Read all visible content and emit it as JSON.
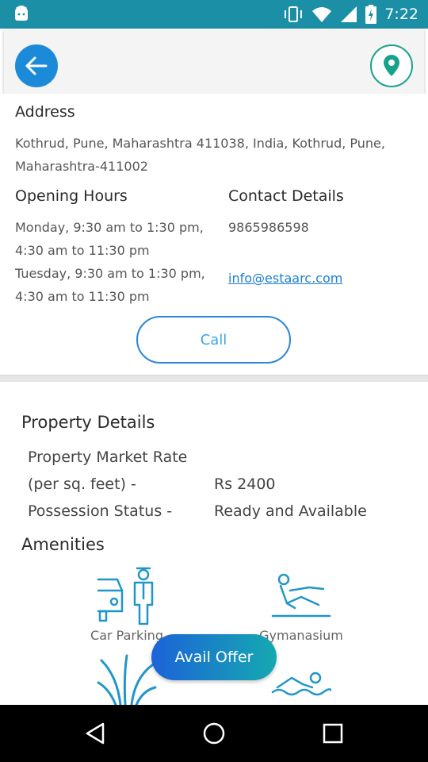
{
  "status_bar": {
    "time": "7:22",
    "color": "#1b8fa5"
  },
  "app_bar": {
    "back_icon": "arrow-left-icon",
    "location_icon": "map-pin-icon"
  },
  "address": {
    "heading": "Address",
    "line1": "Kothrud, Pune, Maharashtra 411038, India, Kothrud, Pune,",
    "line2": "Maharashtra-411002"
  },
  "opening_hours": {
    "heading": "Opening Hours",
    "lines": [
      "Monday, 9:30 am to 1:30 pm,",
      "4:30 am to 11:30 pm",
      "Tuesday, 9:30 am to 1:30 pm,",
      "4:30 am to 11:30 pm"
    ]
  },
  "contact": {
    "heading": "Contact Details",
    "phone": "9865986598",
    "email": "info@estaarc.com"
  },
  "call_label": "Call",
  "property": {
    "heading": "Property Details",
    "rate_label_1": "Property Market Rate",
    "rate_label_2": "(per sq. feet) -",
    "rate_value": "Rs 2400",
    "possession_label": "Possession Status -",
    "possession_value": "Ready and Available"
  },
  "amenities": {
    "heading": "Amenities",
    "items": [
      {
        "label": "Car Parking",
        "icon": "car-parking-icon"
      },
      {
        "label": "Gymanasium",
        "icon": "gym-icon"
      },
      {
        "label": "",
        "icon": "garden-icon"
      },
      {
        "label": "",
        "icon": "swimming-icon"
      }
    ]
  },
  "avail_offer_label": "Avail Offer",
  "colors": {
    "accent_blue": "#1b8bd9",
    "accent_teal": "#17a38b",
    "icon_blue": "#2196c9"
  }
}
